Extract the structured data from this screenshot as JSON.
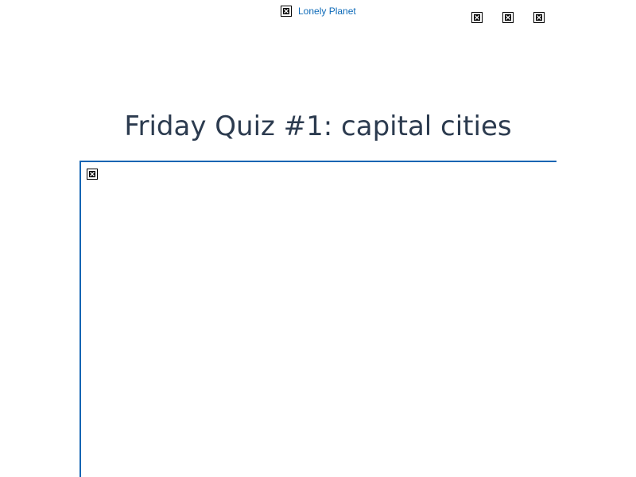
{
  "header": {
    "logo": {
      "alt_text": "Lonely Planet",
      "icon": "broken-image-icon"
    },
    "icons": [
      {
        "icon": "broken-image-icon"
      },
      {
        "icon": "broken-image-icon"
      },
      {
        "icon": "broken-image-icon"
      }
    ]
  },
  "main": {
    "title": "Friday Quiz #1: capital cities",
    "content_image": {
      "icon": "broken-image-icon"
    }
  },
  "colors": {
    "link": "#0d6ab8",
    "title": "#2c3b4f",
    "frame_border": "#1565b3",
    "background": "#ffffff"
  }
}
